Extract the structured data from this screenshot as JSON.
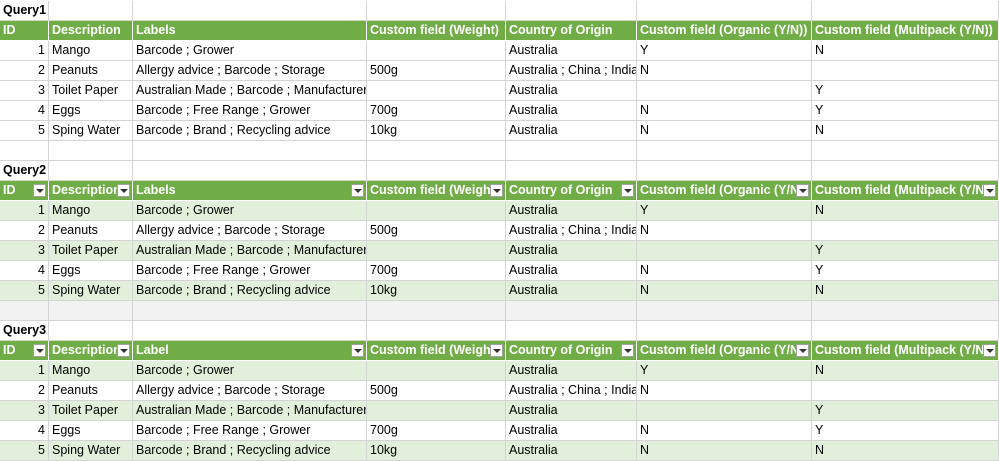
{
  "queries": [
    {
      "title": "Query1",
      "filter_buttons": false,
      "columns": [
        "ID",
        "Description",
        "Labels",
        "Custom field (Weight)",
        "Country of Origin",
        "Custom field (Organic (Y/N))",
        "Custom field (Multipack (Y/N))"
      ],
      "rows": [
        [
          "1",
          "Mango",
          "Barcode ; Grower",
          "",
          "Australia",
          "Y",
          "N"
        ],
        [
          "2",
          "Peanuts",
          "Allergy advice ; Barcode ; Storage",
          "500g",
          "Australia ; China ; India",
          "N",
          ""
        ],
        [
          "3",
          "Toilet Paper",
          "Australian Made ; Barcode ; Manufacturer",
          "",
          "Australia",
          "",
          "Y"
        ],
        [
          "4",
          "Eggs",
          "Barcode ; Free Range ; Grower",
          "700g",
          "Australia",
          "N",
          "Y"
        ],
        [
          "5",
          "Sping Water",
          "Barcode ; Brand ; Recycling advice",
          "10kg",
          "Australia",
          "N",
          "N"
        ]
      ]
    },
    {
      "title": "Query2",
      "filter_buttons": true,
      "columns": [
        "ID",
        "Description",
        "Labels",
        "Custom field (Weight)",
        "Country of Origin",
        "Custom field (Organic (Y/N))",
        "Custom field (Multipack (Y/N))"
      ],
      "rows": [
        [
          "1",
          "Mango",
          "Barcode ; Grower",
          "",
          "Australia",
          "Y",
          "N"
        ],
        [
          "2",
          "Peanuts",
          "Allergy advice ; Barcode ; Storage",
          "500g",
          "Australia ; China ; India",
          "N",
          ""
        ],
        [
          "3",
          "Toilet Paper",
          "Australian Made ; Barcode ; Manufacturer",
          "",
          "Australia",
          "",
          "Y"
        ],
        [
          "4",
          "Eggs",
          "Barcode ; Free Range ; Grower",
          "700g",
          "Australia",
          "N",
          "Y"
        ],
        [
          "5",
          "Sping Water",
          "Barcode ; Brand ; Recycling advice",
          "10kg",
          "Australia",
          "N",
          "N"
        ]
      ]
    },
    {
      "title": "Query3",
      "filter_buttons": true,
      "columns": [
        "ID",
        "Description",
        "Label",
        "Custom field (Weight)",
        "Country of Origin",
        "Custom field (Organic (Y/N))",
        "Custom field (Multipack (Y/N))"
      ],
      "rows": [
        [
          "1",
          "Mango",
          "Barcode ; Grower",
          "",
          "Australia",
          "Y",
          "N"
        ],
        [
          "2",
          "Peanuts",
          "Allergy advice ; Barcode ; Storage",
          "500g",
          "Australia ; China ; India",
          "N",
          ""
        ],
        [
          "3",
          "Toilet Paper",
          "Australian Made ; Barcode ; Manufacturer",
          "",
          "Australia",
          "",
          "Y"
        ],
        [
          "4",
          "Eggs",
          "Barcode ; Free Range ; Grower",
          "700g",
          "Australia",
          "N",
          "Y"
        ],
        [
          "5",
          "Sping Water",
          "Barcode ; Brand ; Recycling advice",
          "10kg",
          "Australia",
          "N",
          "N"
        ]
      ]
    }
  ],
  "colors": {
    "header": "#70ad47",
    "band": "#e2efda",
    "gridline": "#d4d4d4"
  }
}
